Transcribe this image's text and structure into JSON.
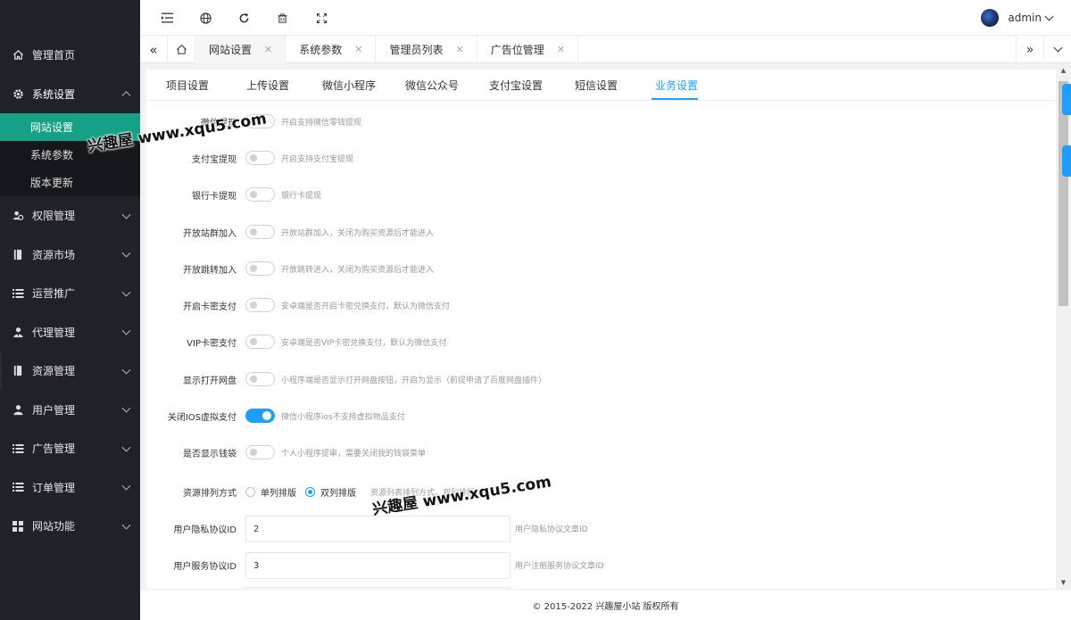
{
  "sidebar": {
    "items": [
      {
        "label": "管理首页",
        "icon": "home-icon"
      },
      {
        "label": "系统设置",
        "icon": "gear-icon",
        "expanded": true,
        "children": [
          {
            "label": "网站设置",
            "active": true
          },
          {
            "label": "系统参数"
          },
          {
            "label": "版本更新"
          }
        ]
      },
      {
        "label": "权限管理",
        "icon": "users-icon"
      },
      {
        "label": "资源市场",
        "icon": "book-icon"
      },
      {
        "label": "运营推广",
        "icon": "list-icon"
      },
      {
        "label": "代理管理",
        "icon": "user-tie-icon"
      },
      {
        "label": "资源管理",
        "icon": "book-icon"
      },
      {
        "label": "用户管理",
        "icon": "user-icon"
      },
      {
        "label": "广告管理",
        "icon": "list-icon"
      },
      {
        "label": "订单管理",
        "icon": "list-icon"
      },
      {
        "label": "网站功能",
        "icon": "grid-icon"
      }
    ]
  },
  "header": {
    "icons": [
      "menu-fold-icon",
      "globe-icon",
      "refresh-icon",
      "clear-icon",
      "fullscreen-icon"
    ],
    "username": "admin"
  },
  "tabs": [
    {
      "label": "网站设置",
      "active": true
    },
    {
      "label": "系统参数"
    },
    {
      "label": "管理员列表"
    },
    {
      "label": "广告位管理"
    }
  ],
  "subtabs": [
    {
      "label": "项目设置"
    },
    {
      "label": "上传设置"
    },
    {
      "label": "微信小程序"
    },
    {
      "label": "微信公众号"
    },
    {
      "label": "支付宝设置"
    },
    {
      "label": "短信设置"
    },
    {
      "label": "业务设置",
      "active": true
    }
  ],
  "form": {
    "switches": [
      {
        "label": "微信提现",
        "on": false,
        "tip": "开启支持微信零钱提现"
      },
      {
        "label": "支付宝提现",
        "on": false,
        "tip": "开启支持支付宝提现"
      },
      {
        "label": "银行卡提现",
        "on": false,
        "tip": "银行卡提现"
      },
      {
        "label": "开放站群加入",
        "on": false,
        "tip": "开放站群加入，关闭为购买资源后才能进入"
      },
      {
        "label": "开放跳转加入",
        "on": false,
        "tip": "开放跳转进入，关闭为购买资源后才能进入"
      },
      {
        "label": "开启卡密支付",
        "on": false,
        "tip": "安卓端是否开启卡密兑换支付，默认为微信支付"
      },
      {
        "label": "VIP卡密支付",
        "on": false,
        "tip": "安卓端是否VIP卡密兑换支付，默认为微信支付"
      },
      {
        "label": "显示打开网盘",
        "on": false,
        "tip": "小程序端是否显示打开网盘按钮，开启为显示（前提申请了百度网盘插件）"
      },
      {
        "label": "关闭IOS虚拟支付",
        "on": true,
        "tip": "微信小程序ios不支持虚拟物品支付"
      },
      {
        "label": "是否显示钱袋",
        "on": false,
        "tip": "个人小程序提审，需要关闭我的钱袋菜单"
      }
    ],
    "sort": {
      "label": "资源排列方式",
      "options": [
        {
          "label": "单列排版",
          "checked": false
        },
        {
          "label": "双列排版",
          "checked": true
        }
      ],
      "tip": "资源列表排列方式，双列排版"
    },
    "inputs": [
      {
        "label": "用户隐私协议ID",
        "value": "2",
        "tip": "用户隐私协议文章ID"
      },
      {
        "label": "用户服务协议ID",
        "value": "3",
        "tip": "用户注册服务协议文章ID"
      }
    ]
  },
  "footer": {
    "text": "© 2015-2022 兴趣屋小站 版权所有"
  },
  "watermark": {
    "text": "兴趣屋 www.xqu5.com"
  },
  "colors": {
    "sidebar_bg": "#20222a",
    "active_green": "#16a085",
    "accent_blue": "#1e9fff"
  }
}
